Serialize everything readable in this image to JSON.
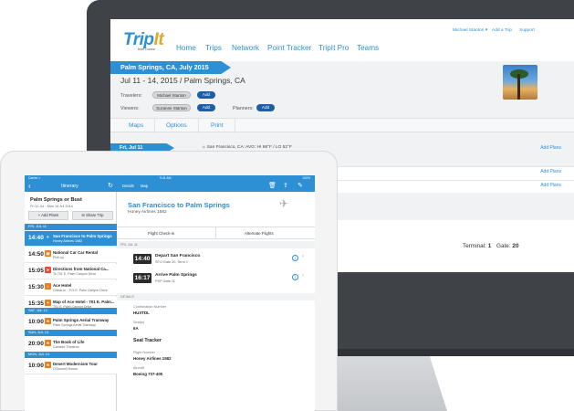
{
  "desktop": {
    "logo": {
      "main": "Trip",
      "accent": "It",
      "sub": "from Concur"
    },
    "nav": [
      "Home",
      "Trips",
      "Network",
      "Point Tracker",
      "TripIt Pro",
      "Teams"
    ],
    "util": {
      "user": "Michael Stanton ▾",
      "add_trip": "Add a Trip",
      "support": "Support"
    },
    "trip_ribbon": "Palm Springs, CA, July 2015",
    "trip_dates": "Jul 11 - 14, 2015 / Palm Springs, CA",
    "travelers_label": "Travelers:",
    "traveler_name": "Michael Stanton",
    "viewers_label": "Viewers:",
    "viewer_name": "Suzanne Stanton",
    "planners_label": "Planners:",
    "add_label": "Add",
    "tabs": [
      "Maps",
      "Options",
      "Print"
    ],
    "day1": {
      "label": "Fri, Jul 11",
      "weather": "☼ San Francisco, CA: AVG: HI 68°F / LO 52°F",
      "add": "Add Plans"
    },
    "day2_add": "Add Plans",
    "day3_add": "Add Plans",
    "terminal_label": "Terminal:",
    "terminal_value": "1",
    "gate_label": "Gate:",
    "gate_value": "20"
  },
  "tablet": {
    "status": {
      "left": "Carrier ≈",
      "center": "9:41 AM",
      "right": "100%"
    },
    "left_title": "Itinerary",
    "trip_title": "Palm Springs or Bust",
    "trip_sub": "Fri 11 Jul - Mon 14 Jul 2014",
    "add_plans": "+ Add Plans",
    "share_trip": "✉ Share Trip",
    "days": [
      "FRI, JUL 11",
      "SAT, JUL 12",
      "SUN, JUL 13",
      "MON, JUL 14"
    ],
    "items_day1": [
      {
        "time": "14:40",
        "name": "San Francisco to Palm Springs",
        "sub": "Honey Airlines 1582",
        "icon": "✈",
        "color": "#2d8fd4"
      },
      {
        "time": "14:50",
        "name": "National Car Car Rental",
        "sub": "Pick-up",
        "icon": "▣",
        "color": "#e67e22"
      },
      {
        "time": "15:05",
        "name": "Directions from National Ca...",
        "sub": "To 701 E. Palm Canyon Drive",
        "icon": "➤",
        "color": "#e74c3c"
      },
      {
        "time": "15:30",
        "name": "Ace Hotel",
        "sub": "Check-in · 701 E. Palm Canyon Drive",
        "icon": "⌂",
        "color": "#e67e22"
      },
      {
        "time": "15:35",
        "name": "Map of Ace Hotel - 701 E. Palm...",
        "sub": "701 E. Palm Canyon Drive",
        "icon": "✦",
        "color": "#e67e22"
      }
    ],
    "items_day2": [
      {
        "time": "10:00",
        "name": "Palm Springs Aerial Tramway",
        "sub": "Palm Springs Aerial Tramway",
        "icon": "★",
        "color": "#e67e22"
      }
    ],
    "items_day3": [
      {
        "time": "20:00",
        "name": "The Book of Life",
        "sub": "Camelot Theatres",
        "icon": "★",
        "color": "#e67e22"
      }
    ],
    "items_day4": [
      {
        "time": "10:00",
        "name": "Desert Modernism Tour",
        "sub": "O'Donnell House",
        "icon": "★",
        "color": "#e67e22"
      }
    ],
    "right_head": {
      "details": "Details",
      "map": "Map"
    },
    "flight_title": "San Francisco to Palm Springs",
    "flight_sub": "Honey Airlines 1582",
    "seg_left": "Flight Check-in",
    "seg_right": "Alternate Flights",
    "section_day": "FRI, JUL 11",
    "depart": {
      "time": "14:40",
      "name": "Depart San Francisco",
      "sub": "SFO Gate 20, Term 1"
    },
    "arrive": {
      "time": "16:17",
      "name": "Arrive Palm Springs",
      "sub": "PSP Gate 11"
    },
    "section_details": "DETAILS",
    "conf_label": "Confirmation Number",
    "conf_value": "HUXTDL",
    "seat_label": "Seat(s)",
    "seat_value": "6A",
    "seat_tracker": "Seat Tracker",
    "flight_no_label": "Flight Number",
    "flight_no_value": "Honey Airlines 1582",
    "aircraft_label": "Aircraft",
    "aircraft_value": "Boeing 737-400"
  }
}
